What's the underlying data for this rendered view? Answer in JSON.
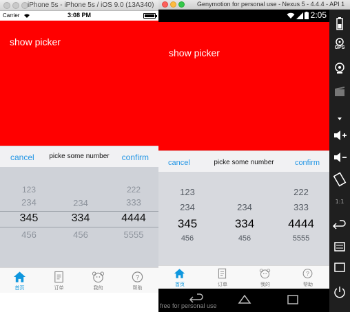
{
  "ios": {
    "window_title": "iPhone 5s - iPhone 5s / iOS 9.0 (13A340)",
    "status": {
      "carrier": "Carrier",
      "time": "3:08 PM",
      "battery_level": 1.0
    },
    "show_picker_label": "show picker",
    "picker": {
      "cancel_label": "cancel",
      "title": "picke some number",
      "confirm_label": "confirm"
    },
    "wheel": {
      "col1": {
        "above2": "123",
        "above1": "234",
        "selected": "345",
        "below1": "456"
      },
      "col2": {
        "above1": "234",
        "selected": "334",
        "below1": "456"
      },
      "col3": {
        "above2": "222",
        "above1": "333",
        "selected": "4444",
        "below1": "5555"
      }
    },
    "tabs": [
      {
        "label": "首页",
        "icon": "home-icon",
        "active": true
      },
      {
        "label": "订单",
        "icon": "document-icon",
        "active": false
      },
      {
        "label": "我的",
        "icon": "bear-face-icon",
        "active": false
      },
      {
        "label": "帮助",
        "icon": "help-icon",
        "active": false
      }
    ]
  },
  "android": {
    "window_title": "Genymotion for personal use - Nexus 5 - 4.4.4 - API 1",
    "status": {
      "clock": "2:05"
    },
    "show_picker_label": "show picker",
    "picker": {
      "cancel_label": "cancel",
      "title": "picke some number",
      "confirm_label": "confirm"
    },
    "wheel": {
      "col1": {
        "above2": "123",
        "above1": "234",
        "selected": "345",
        "below1": "456"
      },
      "col2": {
        "above1": "234",
        "selected": "334",
        "below1": "456"
      },
      "col3": {
        "above2": "222",
        "above1": "333",
        "selected": "4444",
        "below1": "5555"
      }
    },
    "tabs": [
      {
        "label": "首页",
        "icon": "home-icon",
        "active": true
      },
      {
        "label": "订单",
        "icon": "document-icon",
        "active": false
      },
      {
        "label": "我的",
        "icon": "bear-face-icon",
        "active": false
      },
      {
        "label": "帮助",
        "icon": "help-icon",
        "active": false
      }
    ],
    "watermark": "free for personal use",
    "sidebar": {
      "gps_label": "GPS"
    }
  },
  "colors": {
    "red": "#ff0000",
    "accent_blue": "#2396e5",
    "tab_active": "#0f97de",
    "wheel_bg": "#cfd2d8"
  }
}
